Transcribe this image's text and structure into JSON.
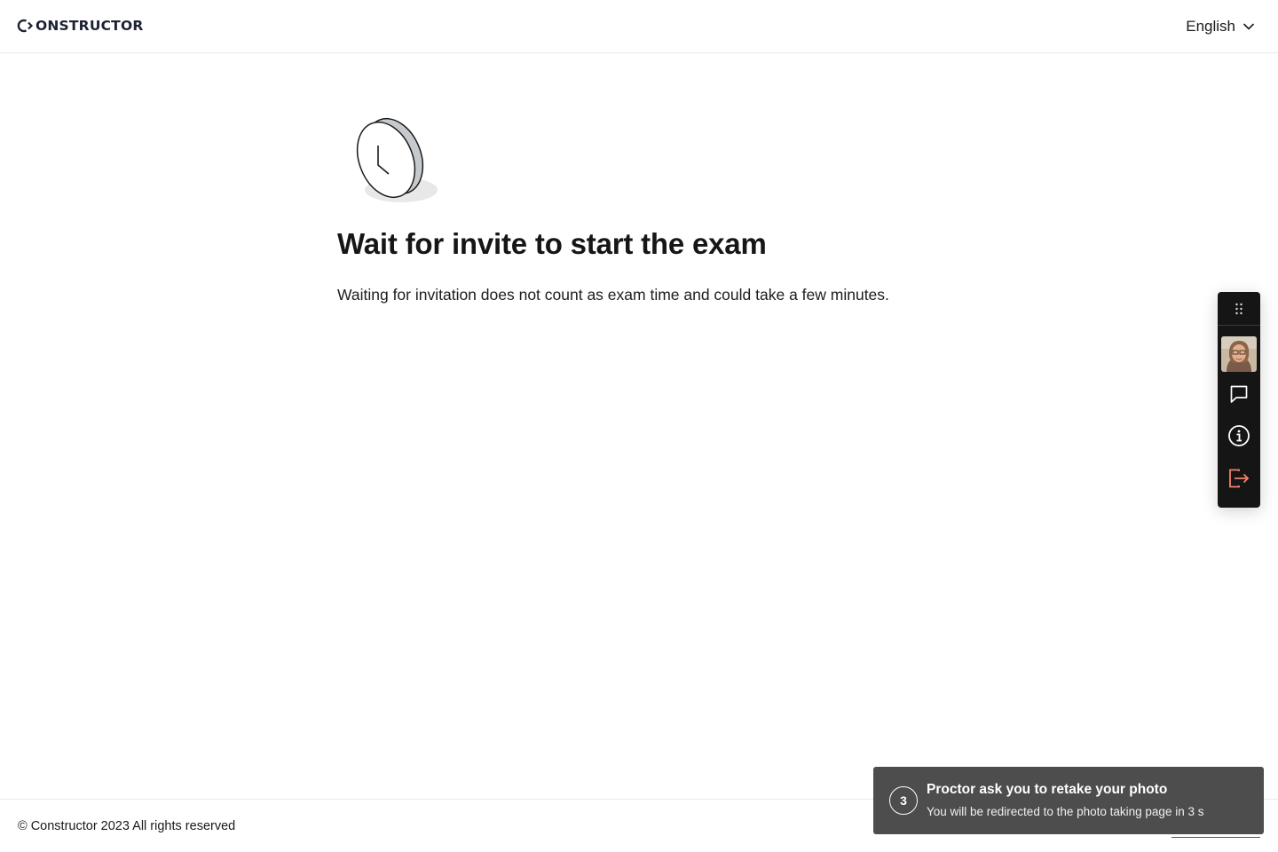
{
  "header": {
    "logo_text": "ONSTRUCTOR",
    "language": {
      "selected": "English",
      "icon": "chevron-down-icon"
    }
  },
  "main": {
    "illustration": "clock-icon",
    "title": "Wait for invite to start the exam",
    "description": "Waiting for invitation does not count as exam time and could take a few minutes."
  },
  "toolbar": {
    "items": [
      {
        "name": "drag-handle",
        "icon": "drag-dots-icon"
      },
      {
        "name": "webcam-preview",
        "icon": "avatar"
      },
      {
        "name": "chat",
        "icon": "chat-bubble-icon"
      },
      {
        "name": "info",
        "icon": "info-icon"
      },
      {
        "name": "exit",
        "icon": "logout-icon",
        "color": "#f0836b"
      }
    ]
  },
  "toast": {
    "countdown": "3",
    "title": "Proctor ask you to retake your photo",
    "message": "You will be redirected to the photo taking page in 3 s"
  },
  "footer": {
    "copyright": "© Constructor 2023 All rights reserved"
  },
  "colors": {
    "toolbar_bg": "#151515",
    "toast_bg": "#4d4d4d",
    "exit_accent": "#f0836b",
    "logo": "#1b2233"
  }
}
